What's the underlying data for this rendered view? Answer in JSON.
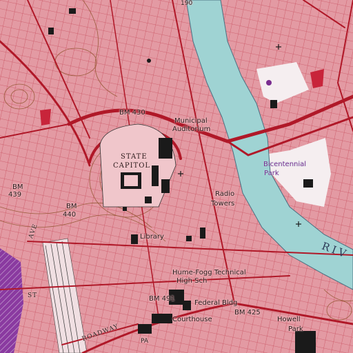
{
  "map": {
    "labels": {
      "hwy_top": "190",
      "municipal": "Municipal",
      "auditorium": "Auditorium",
      "state": "STATE",
      "capitol": "CAPITOL",
      "bm430": "BM 430",
      "bm439_a": "BM",
      "bm439_b": "439",
      "bm440_a": "BM",
      "bm440_b": "440",
      "bicentennial": "Bicentennial",
      "park": "Park",
      "radio": "Radio",
      "towers": "Towers",
      "library": "Library",
      "ave": "AVE",
      "hume_fogg": "Hume-Fogg Technical",
      "high_sch": "High Sch",
      "bm491": "BM 491",
      "federal_bldg": "Federal Bldg",
      "courthouse": "Courthouse",
      "bm425": "BM 425",
      "howell": "Howell",
      "howell_park": "Park",
      "river": "RIV",
      "pa": "PA",
      "broadway": "ROADWAY",
      "st": "ST"
    },
    "colors": {
      "urban_tint": "#e39aa3",
      "river": "#9fd3d3",
      "park": "#f5eef0",
      "roads": "#b01828",
      "contours": "#9b5c3c",
      "buildings": "#1a1a1a",
      "purple_label": "#7a2c8f"
    }
  }
}
